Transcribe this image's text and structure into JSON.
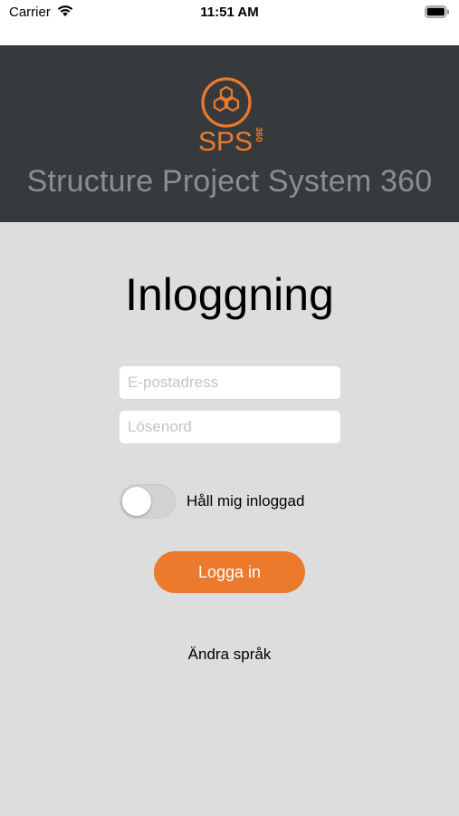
{
  "status_bar": {
    "carrier": "Carrier",
    "time": "11:51 AM",
    "wifi_icon": "wifi-icon",
    "battery_icon": "battery-icon"
  },
  "header": {
    "logo_text": "SPS",
    "logo_sub": "360",
    "app_name": "Structure Project System 360",
    "background": "#373a3d",
    "accent": "#ec7a2c"
  },
  "login": {
    "title": "Inloggning",
    "email_placeholder": "E-postadress",
    "email_value": "",
    "password_placeholder": "Lösenord",
    "password_value": "",
    "remember_label": "Håll mig inloggad",
    "remember_on": false,
    "submit_label": "Logga in",
    "change_language": "Ändra språk"
  }
}
